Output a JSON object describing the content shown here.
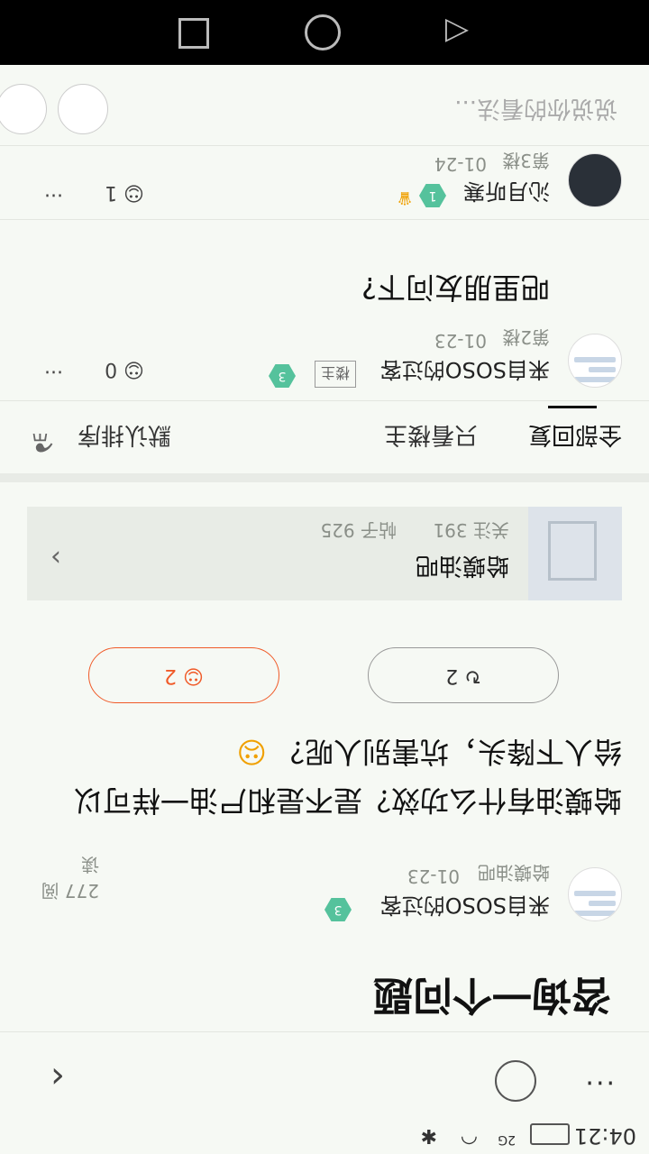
{
  "status": {
    "time": "04:21",
    "network": "2G"
  },
  "header": {
    "back_icon": "chevron-left",
    "share_icon": "share-icon",
    "more_label": "···"
  },
  "post": {
    "title": "咨询一个问题",
    "author": "来自SOSO的过客",
    "level": "3",
    "forum_tag": "蛤蟆油吧",
    "date": "01-23",
    "reads": "277 阅读",
    "body": "蛤蟆油有什么功效？是不是和尸油一样可以给人下降头，坑害别人呢？",
    "share_count": "2",
    "like_count": "2"
  },
  "forum": {
    "name": "蛤蟆油吧",
    "follow": "关注 391",
    "posts": "帖子 925"
  },
  "tabs": [
    {
      "label": "全部回复"
    },
    {
      "label": "只看楼主"
    },
    {
      "label": "默认排序"
    }
  ],
  "replies": [
    {
      "author": "来自SOSO的过客",
      "owner_badge": "楼主",
      "level": "3",
      "floor": "第2楼",
      "date": "01-23",
      "text": "吧里朋友问下?",
      "likes": "0"
    },
    {
      "author": "沁月听寒",
      "level": "1",
      "floor": "第3楼",
      "date": "01-24",
      "likes": "1"
    }
  ],
  "input": {
    "placeholder": "说说你的看法..."
  },
  "colors": {
    "accent": "#f05a28",
    "level_green": "#55c29c",
    "bg": "#f6f9f4"
  }
}
